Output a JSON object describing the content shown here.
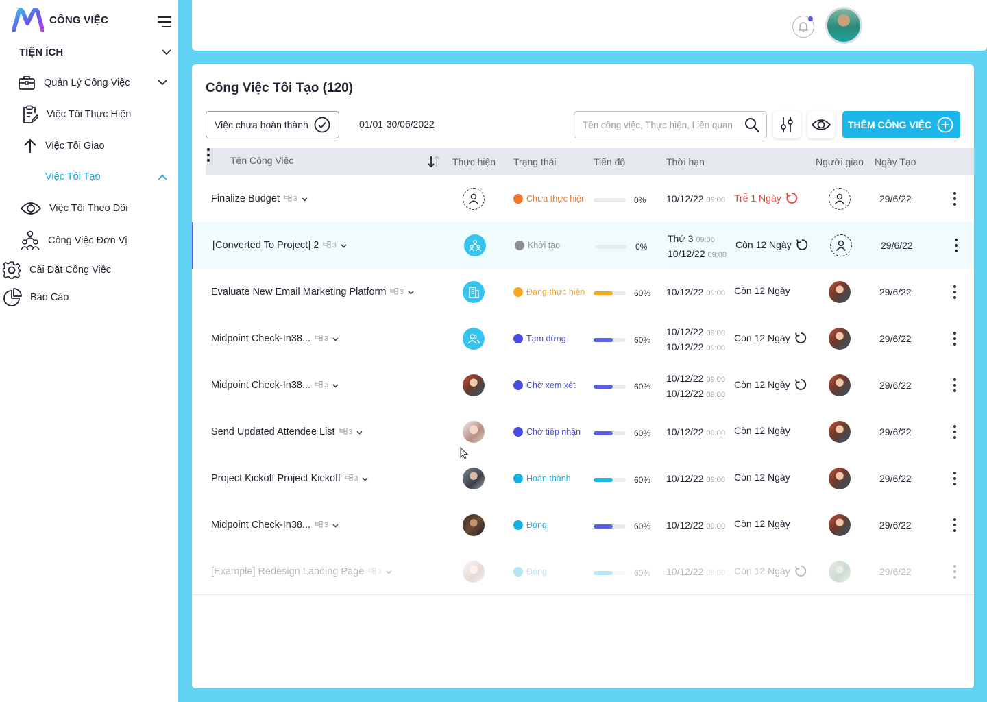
{
  "app": {
    "name": "CÔNG VIỆC"
  },
  "sidebar": {
    "section_title": "TIỆN ÍCH",
    "items": [
      {
        "label": "Quản Lý Công Việc",
        "icon": "briefcase-icon"
      },
      {
        "label": "Việc Tôi Thực Hiện",
        "icon": "clipboard-edit-icon"
      },
      {
        "label": "Việc Tôi Giao",
        "icon": "arrow-up-icon"
      },
      {
        "label": "Việc Tôi Tạo",
        "icon": "",
        "active": true
      },
      {
        "label": "Việc Tôi Theo Dõi",
        "icon": "eye-icon"
      },
      {
        "label": "Công Việc Đơn Vị",
        "icon": "team-icon"
      },
      {
        "label": "Cài Đặt Công Việc",
        "icon": "gear-icon"
      },
      {
        "label": "Báo Cáo",
        "icon": "pie-chart-icon"
      }
    ]
  },
  "main": {
    "title": "Công Việc Tôi Tạo (120)",
    "filter_label": "Việc chưa hoàn thành",
    "date_range": "01/01-30/06/2022",
    "search_placeholder": "Tên công việc, Thực hiện, Liên quan",
    "add_button": "THÊM CÔNG VIỆC",
    "columns": [
      "Tên Công Việc",
      "Thực hiện",
      "Trạng thái",
      "Tiến độ",
      "Thời hạn",
      "Người giao",
      "Ngày Tạo"
    ],
    "rows": [
      {
        "name": "Finalize Budget",
        "subtasks": "3",
        "assignee": "empty",
        "status": "Chưa thực hiện",
        "status_color": "#f2762e",
        "progress": "0%",
        "progress_value": 0,
        "bar_color": "#f2762e",
        "deadline_line1": "10/12/22",
        "deadline_time1": "09:00",
        "deadline_line2": "",
        "deadline_time2": "",
        "remaining": "Trễ 1 Ngày",
        "late": true,
        "repeat": true,
        "giver": "empty",
        "created": "29/6/22"
      },
      {
        "name": "[Converted To Project] 2",
        "subtasks": "3",
        "assignee": "group",
        "status": "Khởi tạo",
        "status_color": "#8e8e93",
        "progress": "0%",
        "progress_value": 0,
        "bar_color": "#8e8e93",
        "deadline_line1": "Thứ 3",
        "deadline_time1": "09:00",
        "deadline_line2": "10/12/22",
        "deadline_time2": "09:00",
        "remaining": "Còn 12 Ngày",
        "late": false,
        "repeat": true,
        "giver": "empty",
        "created": "29/6/22",
        "selected": true
      },
      {
        "name": "Evaluate New Email Marketing Platform",
        "subtasks": "3",
        "assignee": "building",
        "status": "Đang thực hiện",
        "status_color": "#f5a623",
        "progress": "60%",
        "progress_value": 60,
        "bar_color": "#f5a623",
        "deadline_line1": "10/12/22",
        "deadline_time1": "09:00",
        "deadline_line2": "",
        "deadline_time2": "",
        "remaining": "Còn 12 Ngày",
        "late": false,
        "repeat": false,
        "giver": "photo",
        "created": "29/6/22"
      },
      {
        "name": "Midpoint Check-In38...",
        "subtasks": "3",
        "assignee": "users",
        "status": "Tạm dừng",
        "status_color": "#4b4de0",
        "progress": "60%",
        "progress_value": 60,
        "bar_color": "#5a5fe3",
        "deadline_line1": "10/12/22",
        "deadline_time1": "09:00",
        "deadline_line2": "10/12/22",
        "deadline_time2": "09:00",
        "remaining": "Còn 12 Ngày",
        "late": false,
        "repeat": true,
        "giver": "photo",
        "created": "29/6/22"
      },
      {
        "name": "Midpoint Check-In38...",
        "subtasks": "3",
        "assignee": "photo1",
        "status": "Chờ xem xét",
        "status_color": "#4b4de0",
        "progress": "60%",
        "progress_value": 60,
        "bar_color": "#5a5fe3",
        "deadline_line1": "10/12/22",
        "deadline_time1": "09:00",
        "deadline_line2": "10/12/22",
        "deadline_time2": "09:00",
        "remaining": "Còn 12 Ngày",
        "late": false,
        "repeat": true,
        "giver": "photo",
        "created": "29/6/22"
      },
      {
        "name": "Send Updated Attendee List",
        "subtasks": "3",
        "assignee": "photo2",
        "status": "Chờ tiếp nhận",
        "status_color": "#4b4de0",
        "progress": "60%",
        "progress_value": 60,
        "bar_color": "#5a5fe3",
        "deadline_line1": "10/12/22",
        "deadline_time1": "09:00",
        "deadline_line2": "",
        "deadline_time2": "",
        "remaining": "Còn 12 Ngày",
        "late": false,
        "repeat": false,
        "giver": "photo",
        "created": "29/6/22"
      },
      {
        "name": "Project Kickoff Project Kickoff",
        "subtasks": "3",
        "assignee": "photo3",
        "status": "Hoàn thành",
        "status_color": "#17b0e0",
        "progress": "60%",
        "progress_value": 60,
        "bar_color": "#24b7e6",
        "deadline_line1": "10/12/22",
        "deadline_time1": "09:00",
        "deadline_line2": "",
        "deadline_time2": "",
        "remaining": "Còn 12 Ngày",
        "late": false,
        "repeat": false,
        "giver": "photo",
        "created": "29/6/22"
      },
      {
        "name": "Midpoint Check-In38...",
        "subtasks": "3",
        "assignee": "photo4",
        "status": "Đóng",
        "status_color": "#17b0e0",
        "progress": "60%",
        "progress_value": 60,
        "bar_color": "#5a5fe3",
        "deadline_line1": "10/12/22",
        "deadline_time1": "09:00",
        "deadline_line2": "",
        "deadline_time2": "",
        "remaining": "Còn 12 Ngày",
        "late": false,
        "repeat": false,
        "giver": "photo",
        "created": "29/6/22"
      },
      {
        "name": "[Example] Redesign Landing Page",
        "subtasks": "3",
        "assignee": "photo2",
        "status": "Đóng",
        "status_color": "#17b0e0",
        "progress": "60%",
        "progress_value": 60,
        "bar_color": "#24b7e6",
        "deadline_line1": "10/12/22",
        "deadline_time1": "09:00",
        "deadline_line2": "",
        "deadline_time2": "",
        "remaining": "Còn 12 Ngày",
        "late": false,
        "repeat": true,
        "giver": "photo5",
        "created": "29/6/22",
        "faded": true
      }
    ]
  },
  "colors": {
    "accent": "#1cb6ea",
    "background": "#63d3f3",
    "late": "#e8413c"
  }
}
